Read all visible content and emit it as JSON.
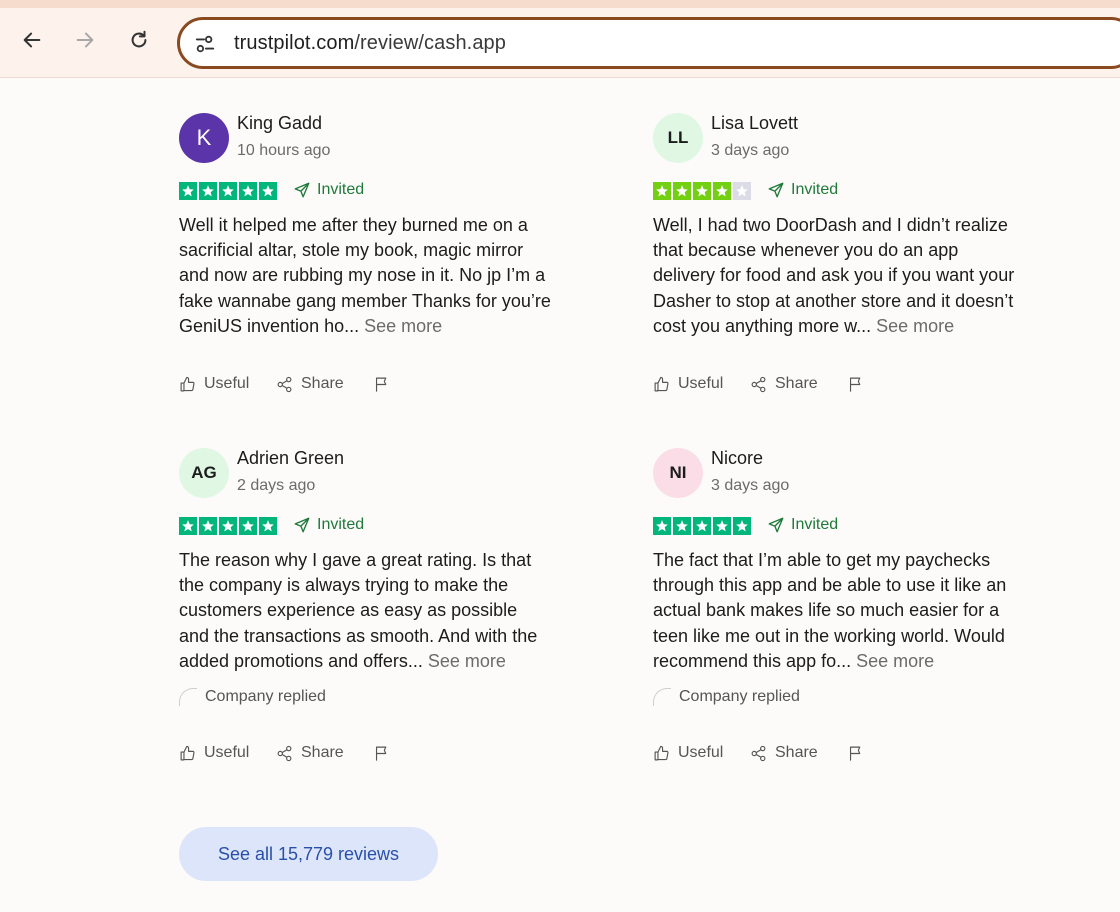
{
  "browser": {
    "url_host": "trustpilot.com",
    "url_path": "/review/cash.app",
    "back_icon": "arrow-left-icon",
    "forward_icon": "arrow-right-icon",
    "reload_icon": "reload-icon",
    "site_info_icon": "tune-icon"
  },
  "colors": {
    "star_green": "#00b67a",
    "star_lightgreen": "#73cf11",
    "star_empty": "#dcdce6",
    "invited_green": "#1f7a3a",
    "cta_bg": "#dde5fb",
    "cta_text": "#2950a8"
  },
  "reviews": [
    {
      "initials": "K",
      "avatar_bg": "#5a34a8",
      "avatar_fg": "#ffffff",
      "name": "King Gadd",
      "date": "10 hours ago",
      "rating": 5,
      "invited_label": "Invited",
      "text": "Well it helped me after they burned me on a\nsacrificial altar, stole my book, magic mirror\nand now are rubbing my nose in it. No jp I’m a\nfake wannabe gang member Thanks for you’re\nGeniUS invention ho... ",
      "see_more": "See more",
      "company_replied": "",
      "useful_label": "Useful",
      "share_label": "Share"
    },
    {
      "initials": "LL",
      "avatar_bg": "#dff7e3",
      "avatar_fg": "#1c1c1c",
      "name": "Lisa Lovett",
      "date": "3 days ago",
      "rating": 4,
      "invited_label": "Invited",
      "text": "Well, I had two DoorDash and I didn’t realize\nthat because whenever you do an app\ndelivery for food and ask you if you want your\nDasher to stop at another store and it doesn’t\ncost you anything more w... ",
      "see_more": "See more",
      "company_replied": "",
      "useful_label": "Useful",
      "share_label": "Share"
    },
    {
      "initials": "AG",
      "avatar_bg": "#dff7e3",
      "avatar_fg": "#1c1c1c",
      "name": "Adrien Green",
      "date": "2 days ago",
      "rating": 5,
      "invited_label": "Invited",
      "text": "The reason why I gave a great rating. Is that\nthe company is always trying to make the\ncustomers experience as easy as possible\nand the transactions as smooth. And with the\nadded promotions and offers... ",
      "see_more": "See more",
      "company_replied": "Company replied",
      "useful_label": "Useful",
      "share_label": "Share"
    },
    {
      "initials": "NI",
      "avatar_bg": "#fbdde8",
      "avatar_fg": "#1c1c1c",
      "name": "Nicore",
      "date": "3 days ago",
      "rating": 5,
      "invited_label": "Invited",
      "text": "The fact that I’m able to get my paychecks\nthrough this app and be able to use it like an\nactual bank makes life so much easier for a\nteen like me out in the working world. Would\nrecommend this app fo... ",
      "see_more": "See more",
      "company_replied": "Company replied",
      "useful_label": "Useful",
      "share_label": "Share"
    }
  ],
  "see_all_label": "See all 15,779 reviews"
}
